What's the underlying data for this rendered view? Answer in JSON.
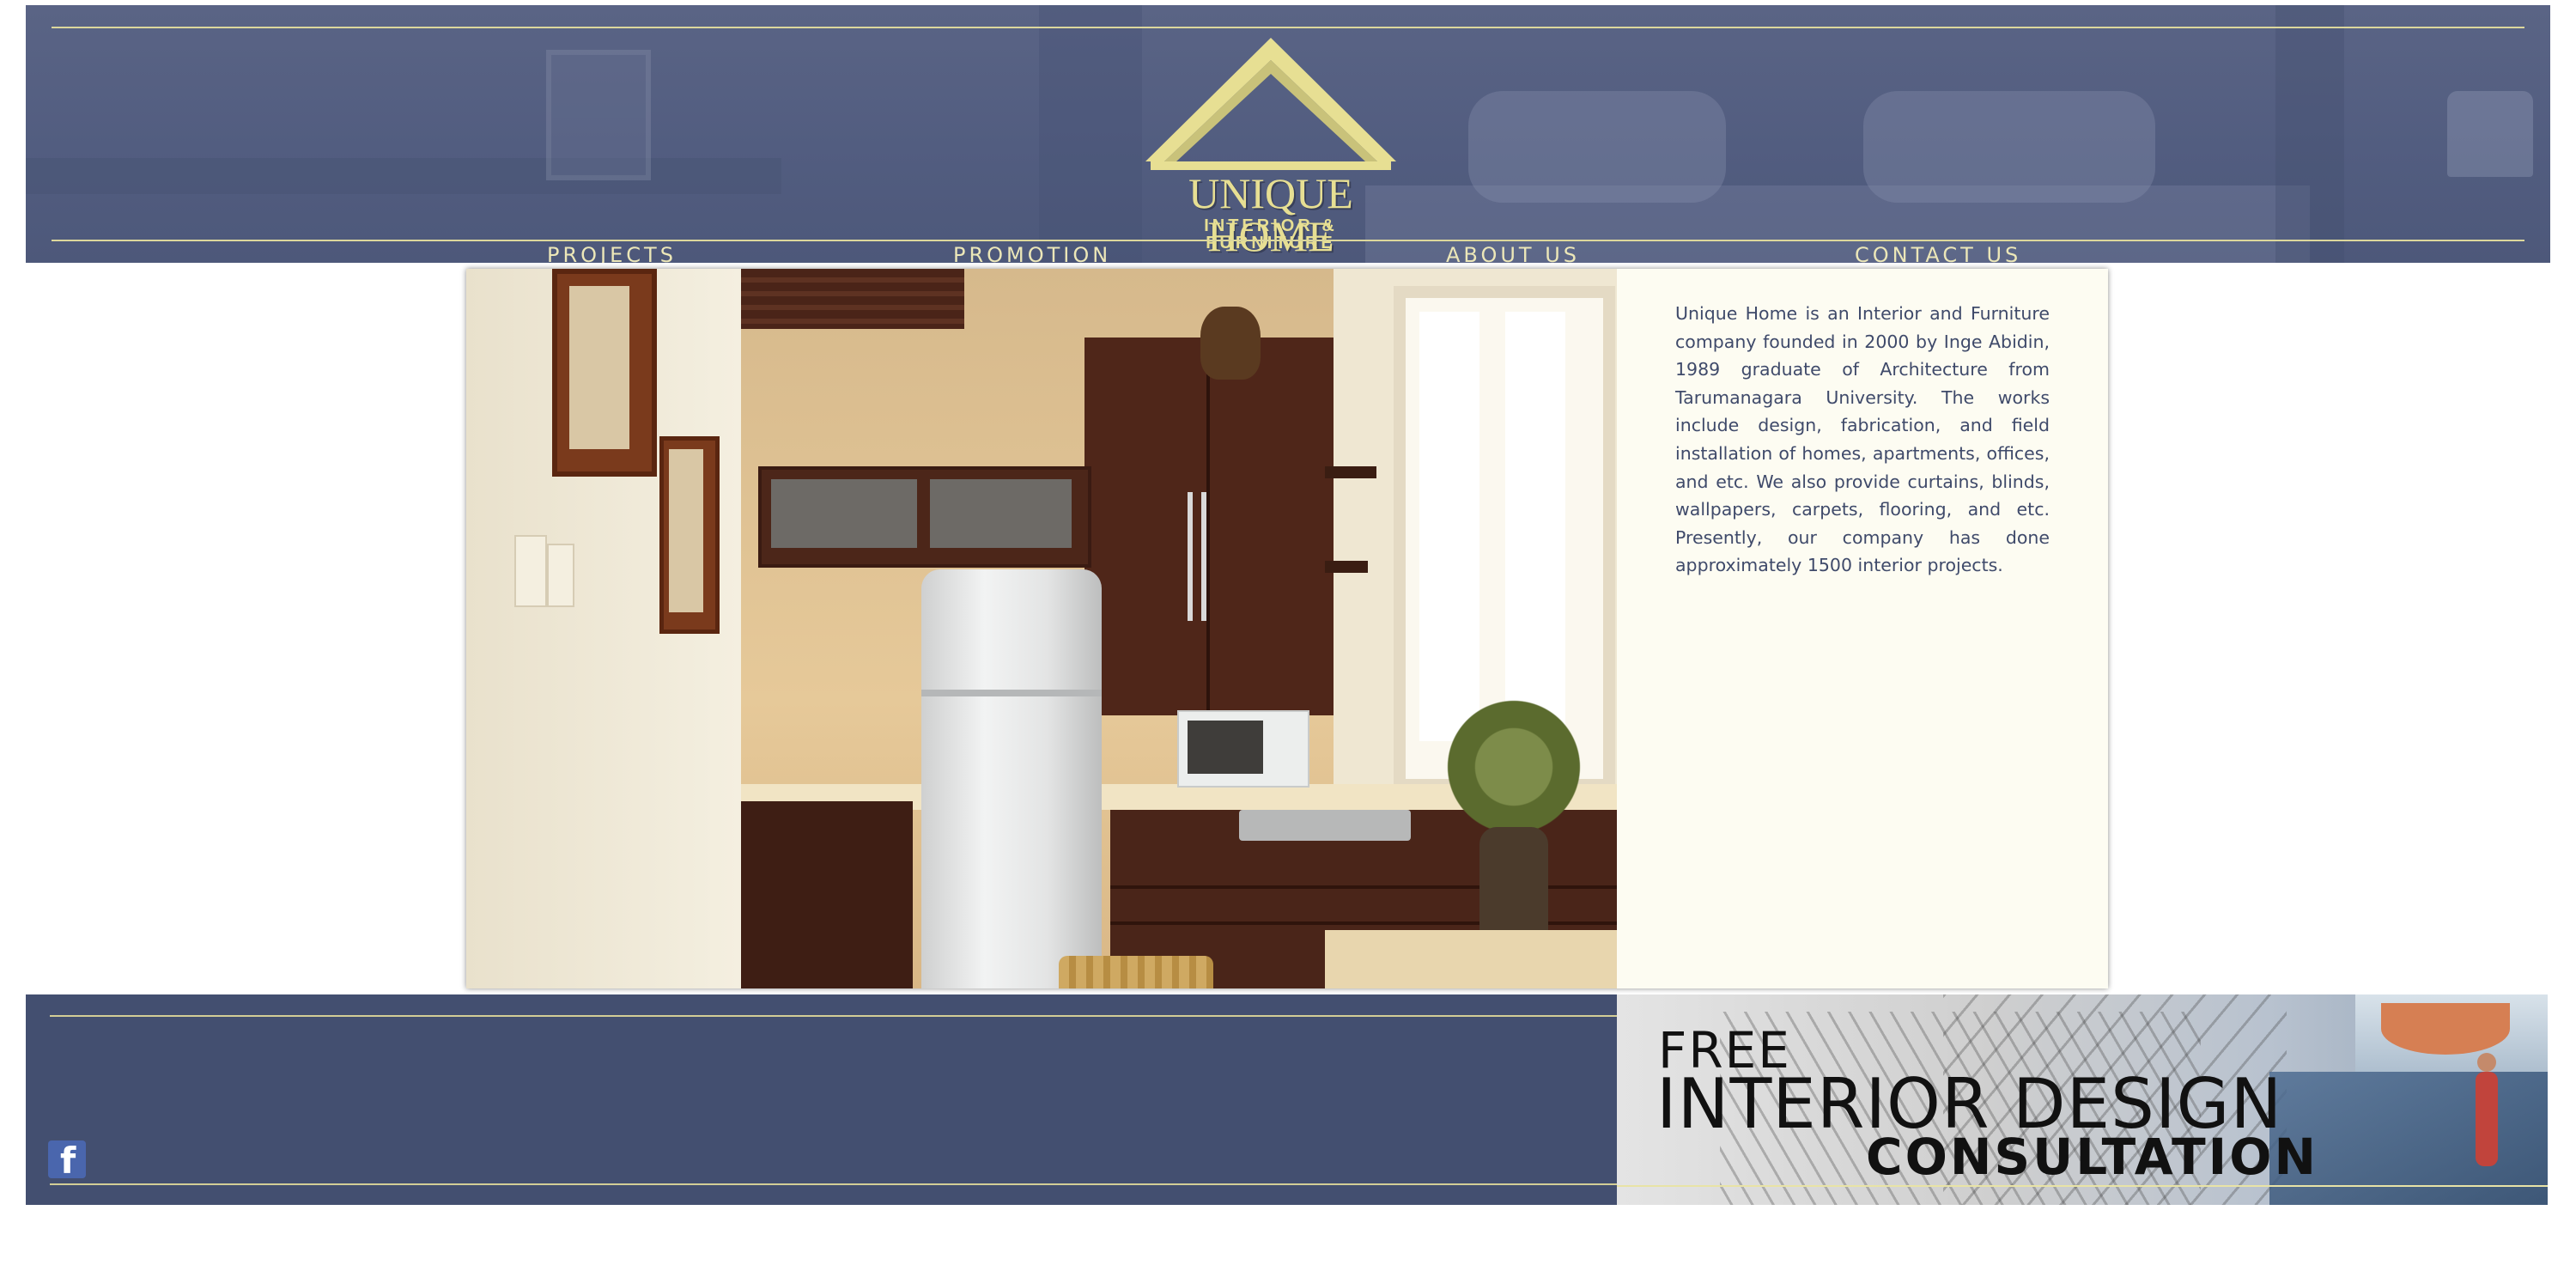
{
  "brand": {
    "title": "UNIQUE HOME",
    "subtitle": "INTERIOR & FURNITURE",
    "logo_color": "#e7df93"
  },
  "nav": {
    "items": [
      {
        "label": "PROJECTS"
      },
      {
        "label": "PROMOTION"
      },
      {
        "label": "ABOUT US"
      },
      {
        "label": "CONTACT US"
      }
    ]
  },
  "about": {
    "text": "Unique Home is an Interior and Furniture company founded in 2000 by Inge Abidin, 1989 graduate of Architecture from Tarumanagara University. The works include design, fabrication, and field installation of homes, apartments, offices, and etc. We also provide curtains, blinds, wallpapers, carpets, flooring, and etc. Presently, our company has done approximately 1500 interior projects."
  },
  "footer": {
    "social_icon": "facebook-icon",
    "social_glyph": "f",
    "promo": {
      "line1": "FREE",
      "line2": "INTERIOR DESIGN",
      "line3": "CONSULTATION"
    }
  },
  "colors": {
    "header_bg": "#525d80",
    "footer_bg": "#434f70",
    "accent_line": "#dcd79c",
    "card_bg": "#fdfcf2",
    "body_text": "#3f4a6a"
  }
}
